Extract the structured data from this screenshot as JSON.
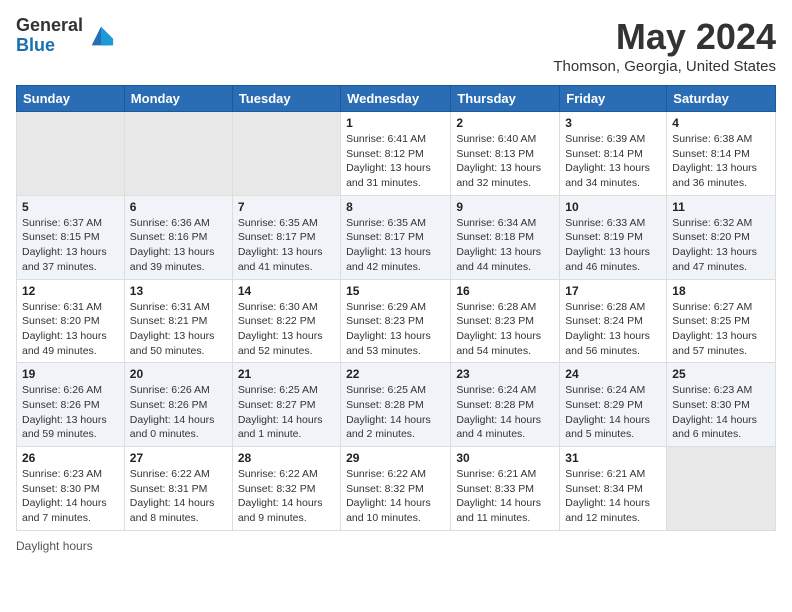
{
  "header": {
    "logo_line1": "General",
    "logo_line2": "Blue",
    "month": "May 2024",
    "location": "Thomson, Georgia, United States"
  },
  "days_of_week": [
    "Sunday",
    "Monday",
    "Tuesday",
    "Wednesday",
    "Thursday",
    "Friday",
    "Saturday"
  ],
  "weeks": [
    [
      {
        "day": "",
        "info": ""
      },
      {
        "day": "",
        "info": ""
      },
      {
        "day": "",
        "info": ""
      },
      {
        "day": "1",
        "info": "Sunrise: 6:41 AM\nSunset: 8:12 PM\nDaylight: 13 hours\nand 31 minutes."
      },
      {
        "day": "2",
        "info": "Sunrise: 6:40 AM\nSunset: 8:13 PM\nDaylight: 13 hours\nand 32 minutes."
      },
      {
        "day": "3",
        "info": "Sunrise: 6:39 AM\nSunset: 8:14 PM\nDaylight: 13 hours\nand 34 minutes."
      },
      {
        "day": "4",
        "info": "Sunrise: 6:38 AM\nSunset: 8:14 PM\nDaylight: 13 hours\nand 36 minutes."
      }
    ],
    [
      {
        "day": "5",
        "info": "Sunrise: 6:37 AM\nSunset: 8:15 PM\nDaylight: 13 hours\nand 37 minutes."
      },
      {
        "day": "6",
        "info": "Sunrise: 6:36 AM\nSunset: 8:16 PM\nDaylight: 13 hours\nand 39 minutes."
      },
      {
        "day": "7",
        "info": "Sunrise: 6:35 AM\nSunset: 8:17 PM\nDaylight: 13 hours\nand 41 minutes."
      },
      {
        "day": "8",
        "info": "Sunrise: 6:35 AM\nSunset: 8:17 PM\nDaylight: 13 hours\nand 42 minutes."
      },
      {
        "day": "9",
        "info": "Sunrise: 6:34 AM\nSunset: 8:18 PM\nDaylight: 13 hours\nand 44 minutes."
      },
      {
        "day": "10",
        "info": "Sunrise: 6:33 AM\nSunset: 8:19 PM\nDaylight: 13 hours\nand 46 minutes."
      },
      {
        "day": "11",
        "info": "Sunrise: 6:32 AM\nSunset: 8:20 PM\nDaylight: 13 hours\nand 47 minutes."
      }
    ],
    [
      {
        "day": "12",
        "info": "Sunrise: 6:31 AM\nSunset: 8:20 PM\nDaylight: 13 hours\nand 49 minutes."
      },
      {
        "day": "13",
        "info": "Sunrise: 6:31 AM\nSunset: 8:21 PM\nDaylight: 13 hours\nand 50 minutes."
      },
      {
        "day": "14",
        "info": "Sunrise: 6:30 AM\nSunset: 8:22 PM\nDaylight: 13 hours\nand 52 minutes."
      },
      {
        "day": "15",
        "info": "Sunrise: 6:29 AM\nSunset: 8:23 PM\nDaylight: 13 hours\nand 53 minutes."
      },
      {
        "day": "16",
        "info": "Sunrise: 6:28 AM\nSunset: 8:23 PM\nDaylight: 13 hours\nand 54 minutes."
      },
      {
        "day": "17",
        "info": "Sunrise: 6:28 AM\nSunset: 8:24 PM\nDaylight: 13 hours\nand 56 minutes."
      },
      {
        "day": "18",
        "info": "Sunrise: 6:27 AM\nSunset: 8:25 PM\nDaylight: 13 hours\nand 57 minutes."
      }
    ],
    [
      {
        "day": "19",
        "info": "Sunrise: 6:26 AM\nSunset: 8:26 PM\nDaylight: 13 hours\nand 59 minutes."
      },
      {
        "day": "20",
        "info": "Sunrise: 6:26 AM\nSunset: 8:26 PM\nDaylight: 14 hours\nand 0 minutes."
      },
      {
        "day": "21",
        "info": "Sunrise: 6:25 AM\nSunset: 8:27 PM\nDaylight: 14 hours\nand 1 minute."
      },
      {
        "day": "22",
        "info": "Sunrise: 6:25 AM\nSunset: 8:28 PM\nDaylight: 14 hours\nand 2 minutes."
      },
      {
        "day": "23",
        "info": "Sunrise: 6:24 AM\nSunset: 8:28 PM\nDaylight: 14 hours\nand 4 minutes."
      },
      {
        "day": "24",
        "info": "Sunrise: 6:24 AM\nSunset: 8:29 PM\nDaylight: 14 hours\nand 5 minutes."
      },
      {
        "day": "25",
        "info": "Sunrise: 6:23 AM\nSunset: 8:30 PM\nDaylight: 14 hours\nand 6 minutes."
      }
    ],
    [
      {
        "day": "26",
        "info": "Sunrise: 6:23 AM\nSunset: 8:30 PM\nDaylight: 14 hours\nand 7 minutes."
      },
      {
        "day": "27",
        "info": "Sunrise: 6:22 AM\nSunset: 8:31 PM\nDaylight: 14 hours\nand 8 minutes."
      },
      {
        "day": "28",
        "info": "Sunrise: 6:22 AM\nSunset: 8:32 PM\nDaylight: 14 hours\nand 9 minutes."
      },
      {
        "day": "29",
        "info": "Sunrise: 6:22 AM\nSunset: 8:32 PM\nDaylight: 14 hours\nand 10 minutes."
      },
      {
        "day": "30",
        "info": "Sunrise: 6:21 AM\nSunset: 8:33 PM\nDaylight: 14 hours\nand 11 minutes."
      },
      {
        "day": "31",
        "info": "Sunrise: 6:21 AM\nSunset: 8:34 PM\nDaylight: 14 hours\nand 12 minutes."
      },
      {
        "day": "",
        "info": ""
      }
    ]
  ],
  "footer": {
    "daylight_label": "Daylight hours"
  }
}
